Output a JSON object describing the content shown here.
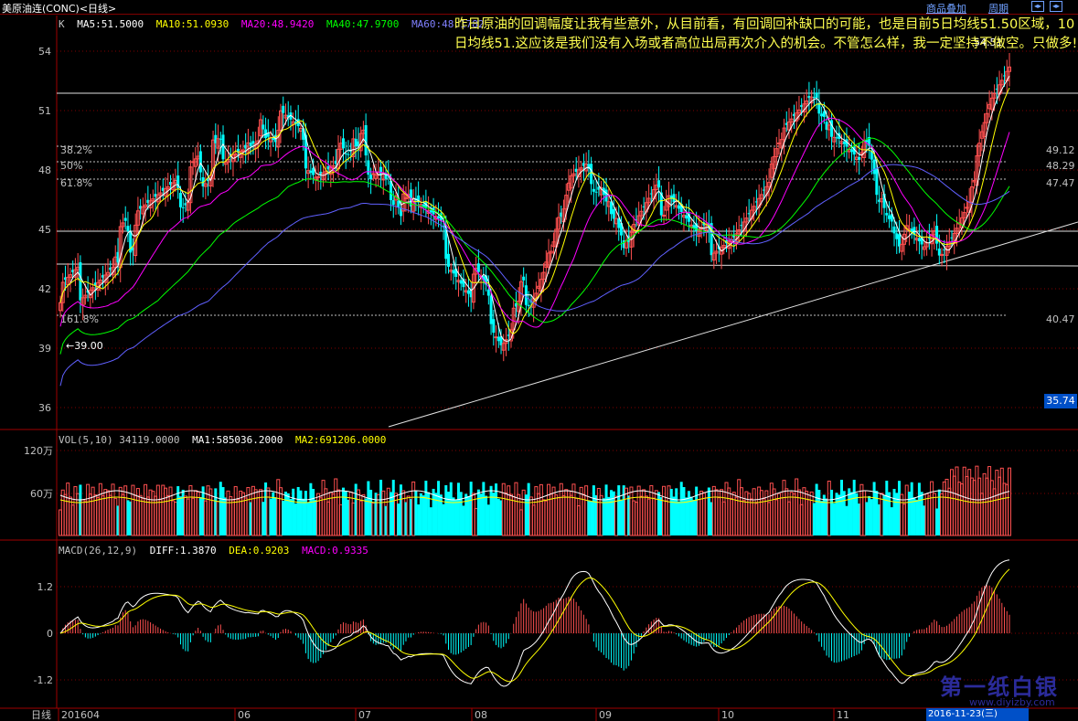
{
  "window": {
    "title": "美原油连(CONC)<日线>",
    "btn_overlay": "商品叠加",
    "btn_period": "周期",
    "nav_left": "◂▸",
    "nav_right": "◂▸"
  },
  "main_legend": {
    "k": "K",
    "ma5": "MA5:51.5000",
    "ma10": "MA10:51.0930",
    "ma20": "MA20:48.9420",
    "ma40": "MA40:47.9700",
    "ma60": "MA60:48.1782"
  },
  "annotation": "昨日原油的回调幅度让我有些意外，从目前看，有回调回补缺口的可能，也是目前5日均线51.50区域，10日均线51.这应该是我们没有入场或者高位出局再次介入的机会。不管怎么样，我一定坚持不做空。只做多!",
  "price_labels": {
    "high_mark": "54.51",
    "low_mark": "←39.00",
    "last_price": "35.74"
  },
  "fib_levels": [
    {
      "label": "38.2%",
      "value": "49.12"
    },
    {
      "label": "50%",
      "value": "48.29"
    },
    {
      "label": "61.8%",
      "value": "47.47"
    },
    {
      "label": "161.8%",
      "value": "40.47"
    }
  ],
  "vol_legend": {
    "vol": "VOL(5,10) 34119.0000",
    "ma1": "MA1:585036.2000",
    "ma2": "MA2:691206.0000"
  },
  "macd_legend": {
    "macd": "MACD(26,12,9)",
    "diff": "DIFF:1.3870",
    "dea": "DEA:0.9203",
    "macdv": "MACD:0.9335"
  },
  "footer": {
    "period": "日线",
    "current_date": "2016-11-23(三)"
  },
  "watermark": {
    "name": "第一纸白银",
    "url": "www.diyizby.com"
  },
  "colors": {
    "up": "#ff5050",
    "down": "#00ffff",
    "ma5": "#ffff00",
    "ma10": "#ffffff",
    "ma20": "#ff00ff",
    "ma40": "#00ff00",
    "ma60": "#6060ff",
    "grid": "#800000"
  },
  "chart_data": [
    {
      "type": "candlestick",
      "title": "美原油连(CONC)<日线>",
      "y_ticks": [
        54,
        51,
        48,
        45,
        42,
        39,
        36
      ],
      "ylim": [
        35.0,
        55.0
      ],
      "x_ticks": [
        "201604",
        "06",
        "07",
        "08",
        "09",
        "10",
        "11"
      ],
      "series_encoded": "Fyn|Iuxr|Ovxt|Pz|y|Oy|xN|HzPx|CQHA|DIAE|ABAF|CCDE|CIFG|KKEI|GKHJ|EI|G|EGAI|DHAD|DFBH|CDAF|BDDE|FFCL|BDDG|IJKI|LKKO|JKMP|FEMO|EE|A|HDIL|JHJM|JJMO|MKRQ|PKSS|SRTW|VUVZ|SSPU|SUTW|UVTW|TWST|UUTW|SSYX|WWWb|VXVb|UaWd|ZZXZ|SUZY|QPWW|LLLP|HLGM|KMMP|SPXV|WaVb|VVWb|VXWX|SXTT|QNQT|MNMO|KJKO|PKSP|UPVW|SPUX|SSUW|SSUV|QPPT|LMLS|HJIK|EHFF|BDCE|ACBA|AEDF|CFDG|FDHG|DIEI|GHFH|ECGG|F|C|E|GHGH|EFFG|ABBD|A|AE|AB|B|BAFF|GGEK|JILK|KOMM|NRRQ|NRQU|VVRa|UYab|YZYX|SVSV|SNRR|KMNO|LIKK|HIJK|HHJK|FGIK|EHHE|BAAB|A|ABCD|AB|B|ABBB|ACCE|CDEG|DEFF|EEEB|CBDC|AAAB|B|BCAG|AEAB|BBBE|EBGF|EHEI|BCCG|AB|A|AAEB|BC|AEBF|BAFF|DEEE|DDEF|DGEH|BEAF|BDBE|EBGE|BDDD|BCBC|FEGE|EEFG|EGGI|ECGH|GFIJ|GIHK|LKKP|NMQP|LOLQ|MMMN|QNRS|VWUX|YXXa|UTVV|TTSS|RRRT|TPRS|NNMQ|KKLL|GJJJ|HIIJ|IJJK|GHHJ|BGAC|DEEE|BCAE|GCIF|EEFI|IJIK|MJNN|OPQQ|RPRS|SUTV|QPRQ|MPMQ|KKJN|GKHJ|GGGH|FGEH|DCGF|CBDD|CCDD|CFDG|EDGG|GGHJ|GGGJ|HGHI|JLKN|IKIM|FFGH|CFEF|DAED|BABB|ABAB|AAAB|AA|A|BAAD|BBBB|AA|A|AB|B|AA|A|BBBD|CDDE|DFFF|FFEI|HIHI|GJJJ|KLNM|LMLN|JJIN|IHHK|FGFH|EEFE|CCEE|ACBE|BABA|ACAC|AAAD|BBDD|AC|B|CBCC|AACD|BB|A|CBCC|CCDD|EEEE|EDGH|HIHI|IKJK|JLKL|JLLL|KKMM|NMNN|PPPQ|OQOQ|NNNN|LNML|IIJJ|HKJJ|LKLM|NMOO|PPQQ|UTVV|ZZab|bbbc|fefg|hfjh|ehgi|cbee|ceeg|fdhj|ffgh|hhhh|ffgh|eegg|bdeg|cbef|XaZc|UWWW|RRTT|PQRQ|NOON|LLNL|JLLK|HFHK|EEEG|DBBD|A|AB|CBDE|EHEH|FGFH|GGFH|EEEE|DCDE|BBCD|AAAB|AAB|AAAA|BBBB|BBBC|CEDD|DDDF|DFFE|FFEF|EGFF|GJHJ|IJKL|IIKK|JKLL|KKLM|NLMN|NNMN|ONOO|NPOP|QRRR|RSRR|RSSR|SRST|SQSR|OOPO|MNPQ|NNPP|LNLO|MNMO|HHIK|GHHJ|FGGG|DFFF|CCCD|ACAC|AAAA|A|A|A|B|ABAB|CCBE|EEEF|FEFE|FFEG|EEEF|CEDE|BABB|A|ACBE|ACBC|BBBB|AADC|BBCD|BB|BABB|A|BAAB|CCBE|FFFH|GHIH|JKKL|LOOP|RSSS|RSTT|VVUY|XXXa|aYbb|YaYb|ZaZa|VVVX|STTU|RRRQ|OPOO|NNMM|KKKL|IJJK|HHFG|DFFG|DCEE|BBCC|A|AABB|ACBD|CDDE|FFEG|FFFF|IGII|IIJI|JKLN|MMNN|OPQR|QQRS|UTWV|WWYX|aaac|dccd|ffgh|gjij|kjjl|kkml",
      "series_note": "Each '|' group is one bar; letters encode relative values decoded by the page script."
    }
  ]
}
